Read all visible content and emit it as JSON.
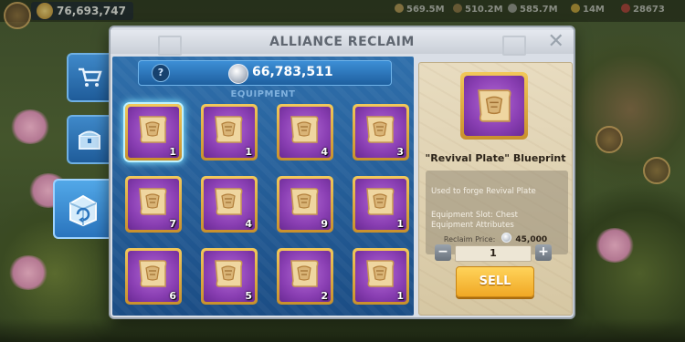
{
  "hud": {
    "power": "76,693,747",
    "resources": [
      "569.5M",
      "510.2M",
      "585.7M",
      "14M",
      "28673"
    ]
  },
  "modal": {
    "title": "ALLIANCE RECLAIM",
    "close_icon": "close-icon"
  },
  "currency": {
    "help": "?",
    "value": "66,783,511"
  },
  "section_label": "EQUIPMENT",
  "items": [
    {
      "qty": "1",
      "selected": true
    },
    {
      "qty": "1"
    },
    {
      "qty": "4"
    },
    {
      "qty": "3"
    },
    {
      "qty": "7"
    },
    {
      "qty": "4"
    },
    {
      "qty": "9"
    },
    {
      "qty": "1"
    },
    {
      "qty": "6"
    },
    {
      "qty": "5"
    },
    {
      "qty": "2"
    },
    {
      "qty": "1"
    }
  ],
  "detail": {
    "name": "\"Revival Plate\" Blueprint",
    "description": "Used to forge Revival Plate",
    "slot": "Equipment Slot: Chest",
    "attributes": "Equipment Attributes",
    "price_label": "Reclaim Price:",
    "price_value": "45,000",
    "quantity": "1",
    "minus": "−",
    "plus": "+",
    "sell_label": "SELL"
  },
  "colors": {
    "panel_blue": "#2f6fab",
    "slot_purple": "#8a3fb3",
    "slot_gold": "#f2c85a",
    "sell_gold": "#f0a825"
  }
}
